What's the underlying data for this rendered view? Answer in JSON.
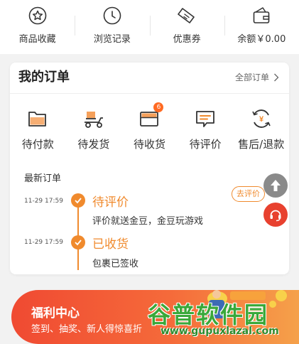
{
  "quick": {
    "favorites": "商品收藏",
    "history": "浏览记录",
    "coupons": "优惠券",
    "balance": "余额￥0.00"
  },
  "orders": {
    "title": "我的订单",
    "all": "全部订单",
    "statuses": {
      "pending_payment": "待付款",
      "pending_shipment": "待发货",
      "pending_receipt": "待收货",
      "pending_review": "待评价",
      "after_sales": "售后/退款"
    },
    "receipt_badge": "6",
    "recent_title": "最新订单",
    "timeline": [
      {
        "time": "11-29 17:59",
        "status": "待评价",
        "desc": "评价就送金豆，金豆玩游戏"
      },
      {
        "time": "11-29 17:59",
        "status": "已收货",
        "desc": "包裹已签收"
      }
    ],
    "review_button": "去评价"
  },
  "welfare": {
    "title": "福利中心",
    "subtitle": "签到、抽奖、新人得惊喜折"
  },
  "watermark": {
    "logo": "谷普软件园",
    "url": "www.gupuxlazal.com"
  },
  "colors": {
    "accent": "#f08a2d",
    "badge": "#ff6a22",
    "service": "#e8412f"
  }
}
